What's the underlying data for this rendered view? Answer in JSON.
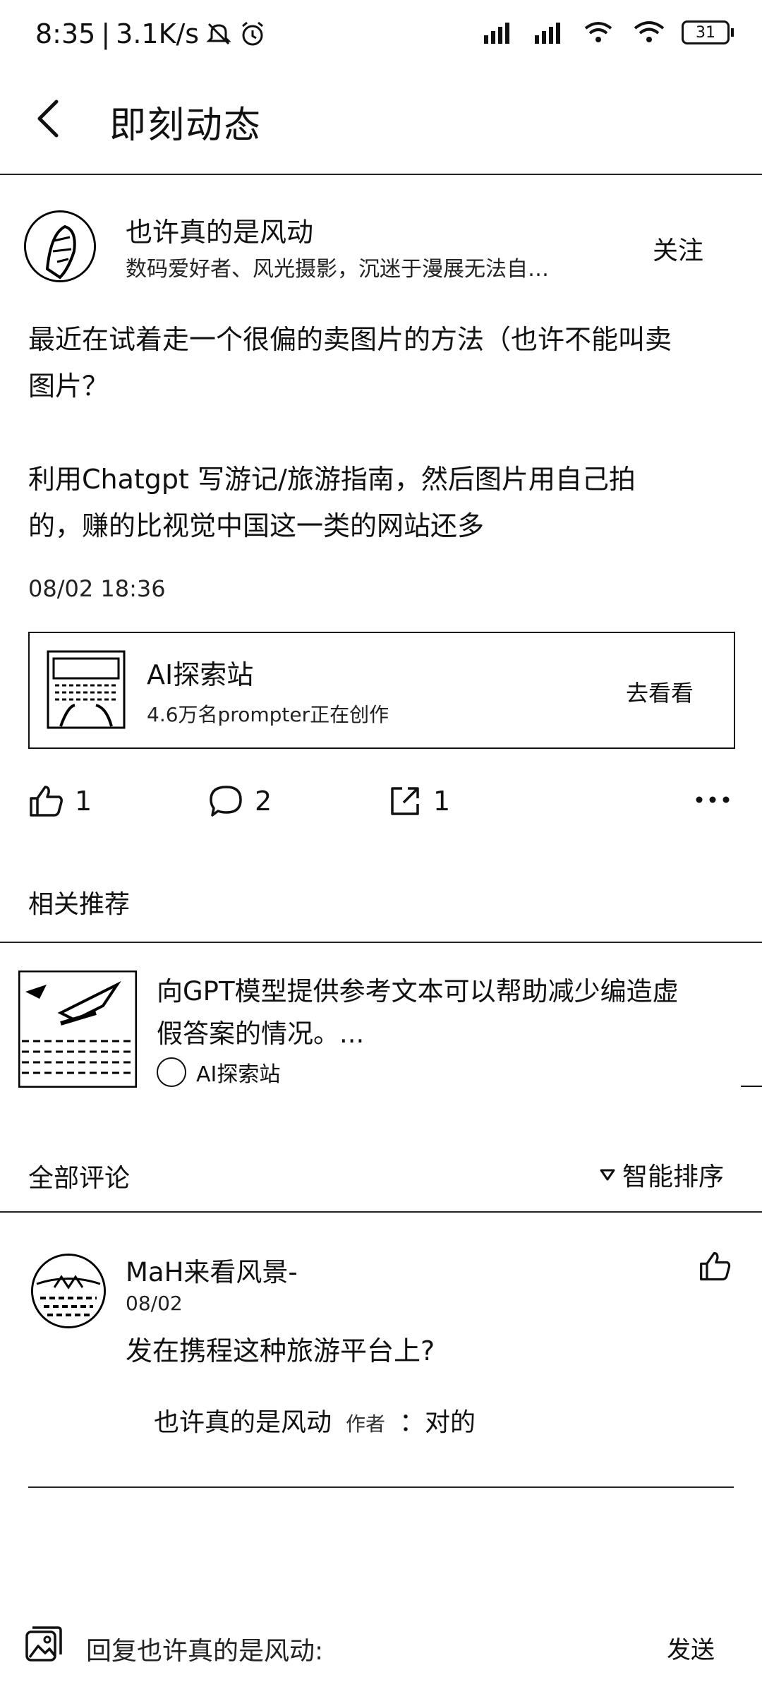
{
  "status": {
    "time": "8:35",
    "speed": "3.1K/s",
    "battery": "31"
  },
  "header": {
    "title": "即刻动态"
  },
  "post": {
    "author": "也许真的是风动",
    "bio": "数码爱好者、风光摄影，沉迷于漫展无法自…",
    "follow_label": "关注",
    "text_line1": "最近在试着走一个很偏的卖图片的方法（也许不能叫卖",
    "text_line2": "图片？",
    "text_line3": "利用Chatgpt 写游记/旅游指南，然后图片用自己拍",
    "text_line4": "的，赚的比视觉中国这一类的网站还多",
    "time": "08/02 18:36"
  },
  "topic_card": {
    "name": "AI探索站",
    "subtitle": "4.6万名prompter正在创作",
    "action": "去看看"
  },
  "actions": {
    "likes": "1",
    "comments": "2",
    "shares": "1"
  },
  "related": {
    "heading": "相关推荐",
    "item_line1": "向GPT模型提供参考文本可以帮助减少编造虚",
    "item_line2": "假答案的情况。...",
    "item_source": "AI探索站"
  },
  "comments_section": {
    "heading": "全部评论",
    "sort_label": "智能排序",
    "comments": [
      {
        "author": "MaH来看风景-",
        "date": "08/02",
        "text": "发在携程这种旅游平台上?",
        "reply_author": "也许真的是风动",
        "reply_badge": "作者",
        "reply_text": "：对的"
      }
    ]
  },
  "reply_bar": {
    "placeholder": "回复也许真的是风动:",
    "send_label": "发送"
  }
}
